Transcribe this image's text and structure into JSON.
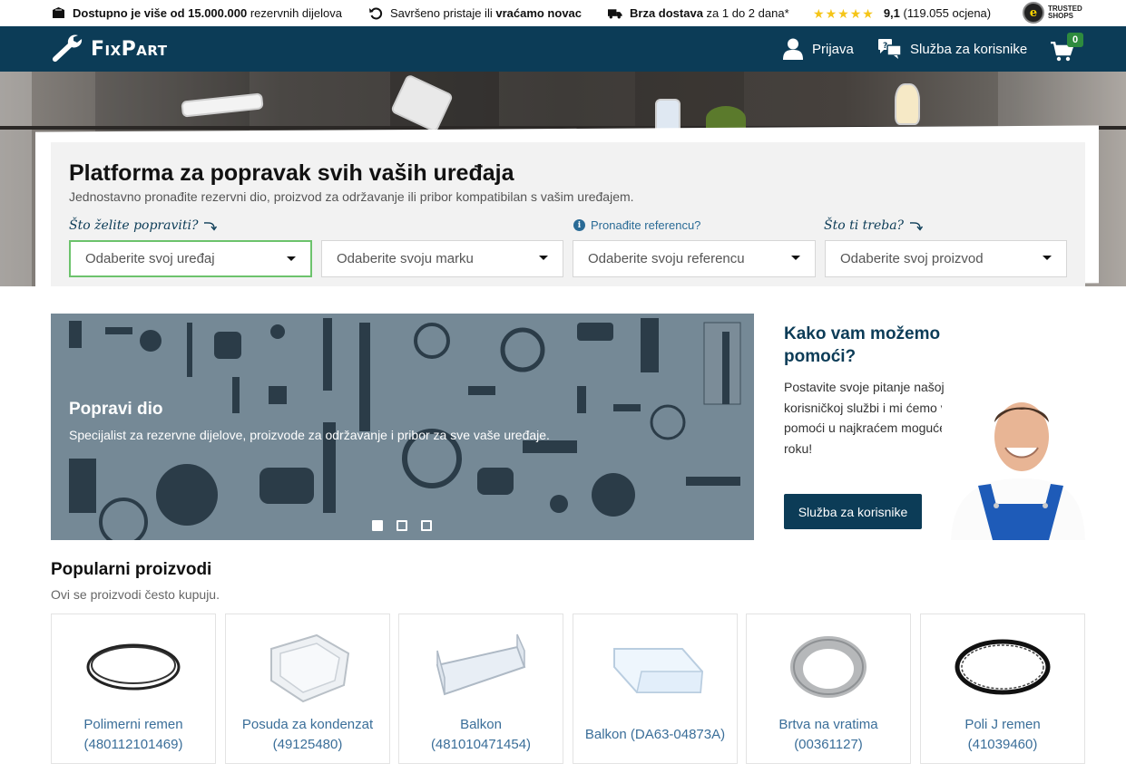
{
  "topbar": {
    "stock_bold": "Dostupno je više od 15.000.000",
    "stock_rest": "rezervnih dijelova",
    "return_text": "Savršeno pristaje ili",
    "return_bold": "vraćamo novac",
    "delivery_bold": "Brza dostava",
    "delivery_rest": "za 1 do 2 dana*",
    "rating_score": "9,1",
    "rating_count": "(119.055 ocjena)",
    "trusted_line1": "TRUSTED",
    "trusted_line2": "SHOPS"
  },
  "header": {
    "logo": "FixPart",
    "login": "Prijava",
    "support": "Služba za korisnike",
    "cart_count": "0"
  },
  "search": {
    "title": "Platforma za popravak svih vaših uređaja",
    "subtitle": "Jednostavno pronađite rezervni dio, proizvod za održavanje ili pribor kompatibilan s vašim uređajem.",
    "hint_repair": "Što želite popraviti?",
    "hint_reference": "Pronađite referencu?",
    "hint_need": "Što ti treba?",
    "selects": [
      "Odaberite svoj uređaj",
      "Odaberite svoju marku",
      "Odaberite svoju referencu",
      "Odaberite svoj proizvod"
    ]
  },
  "banner": {
    "title": "Popravi dio",
    "text": "Specijalist za rezervne dijelove, proizvode za održavanje i pribor za sve vaše uređaje."
  },
  "help": {
    "title": "Kako vam možemo pomoći?",
    "text": "Postavite svoje pitanje našoj korisničkoj službi i mi ćemo vam pomoći u najkraćem mogućem roku!",
    "button": "Služba za korisnike"
  },
  "popular": {
    "title": "Popularni proizvodi",
    "subtitle": "Ovi se proizvodi često kupuju.",
    "products": [
      {
        "name": "Polimerni remen",
        "ref": "(480112101469)"
      },
      {
        "name": "Posuda za kondenzat",
        "ref": "(49125480)"
      },
      {
        "name": "Balkon",
        "ref": "(481010471454)"
      },
      {
        "name": "Balkon (DA63-04873A)",
        "ref": ""
      },
      {
        "name": "Brtva na vratima",
        "ref": "(00361127)"
      },
      {
        "name": "Poli J remen",
        "ref": "(41039460)"
      }
    ]
  },
  "colors": {
    "brand": "#0c3c57",
    "link": "#3a6e99",
    "active_border": "#6cc36c",
    "badge": "#2e8b3e",
    "star": "#f5c518"
  }
}
